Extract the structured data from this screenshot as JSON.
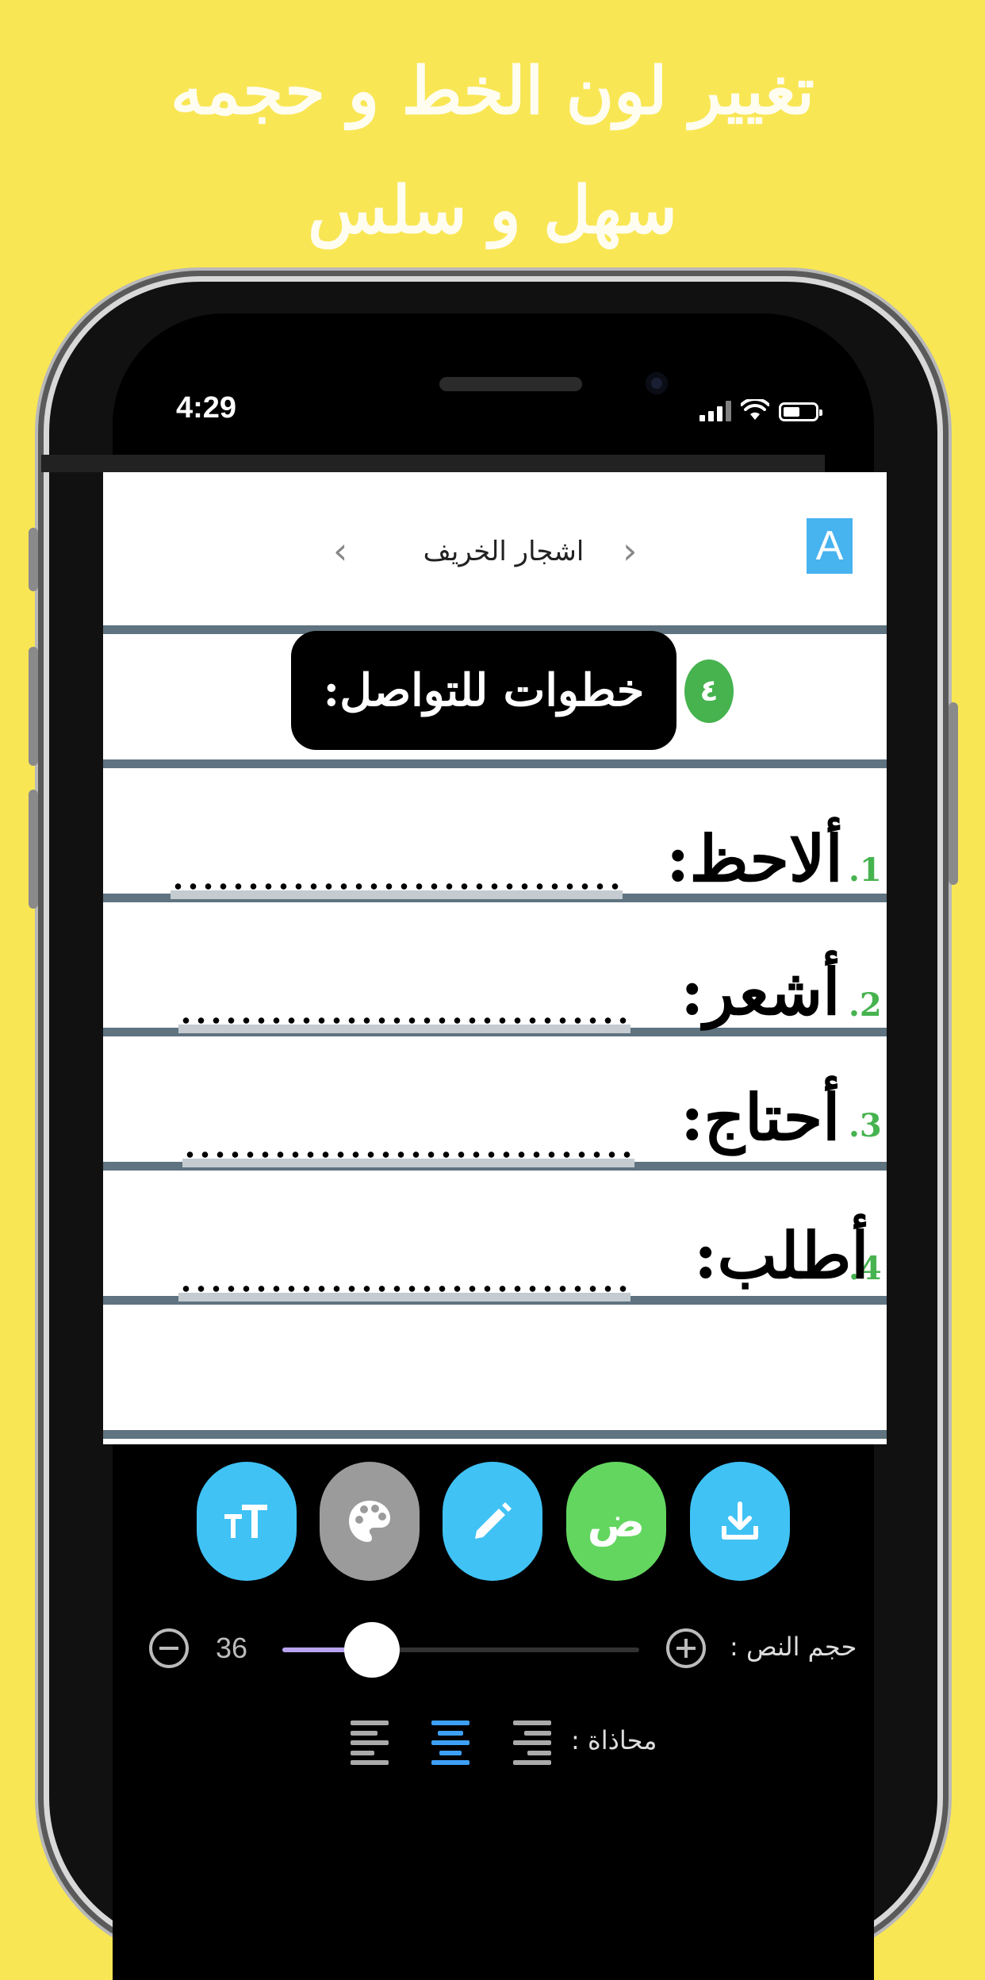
{
  "promo": {
    "line1": "تغيير لون الخط و حجمه",
    "line2": "سهل و سلس"
  },
  "status_bar": {
    "time": "4:29"
  },
  "doc_nav": {
    "title": "اشجار الخريف",
    "badge": "A"
  },
  "worksheet": {
    "heading": "خطوات للتواصل:",
    "heading_number": "٤",
    "items": [
      {
        "number": ".1",
        "label": "ألاحظ:"
      },
      {
        "number": ".2",
        "label": "أشعر:"
      },
      {
        "number": ".3",
        "label": "أحتاج:"
      },
      {
        "number": ".4",
        "label": "أطلب:"
      }
    ]
  },
  "toolbar": {
    "arabic_letter": "ض",
    "colors": {
      "blue": "#40c2f5",
      "gray": "#9b9b9b",
      "green": "#63d660"
    }
  },
  "text_size": {
    "label": "حجم النص :",
    "value": "36",
    "fraction": 0.25
  },
  "alignment": {
    "label": "محاذاة :",
    "selected": "center"
  }
}
